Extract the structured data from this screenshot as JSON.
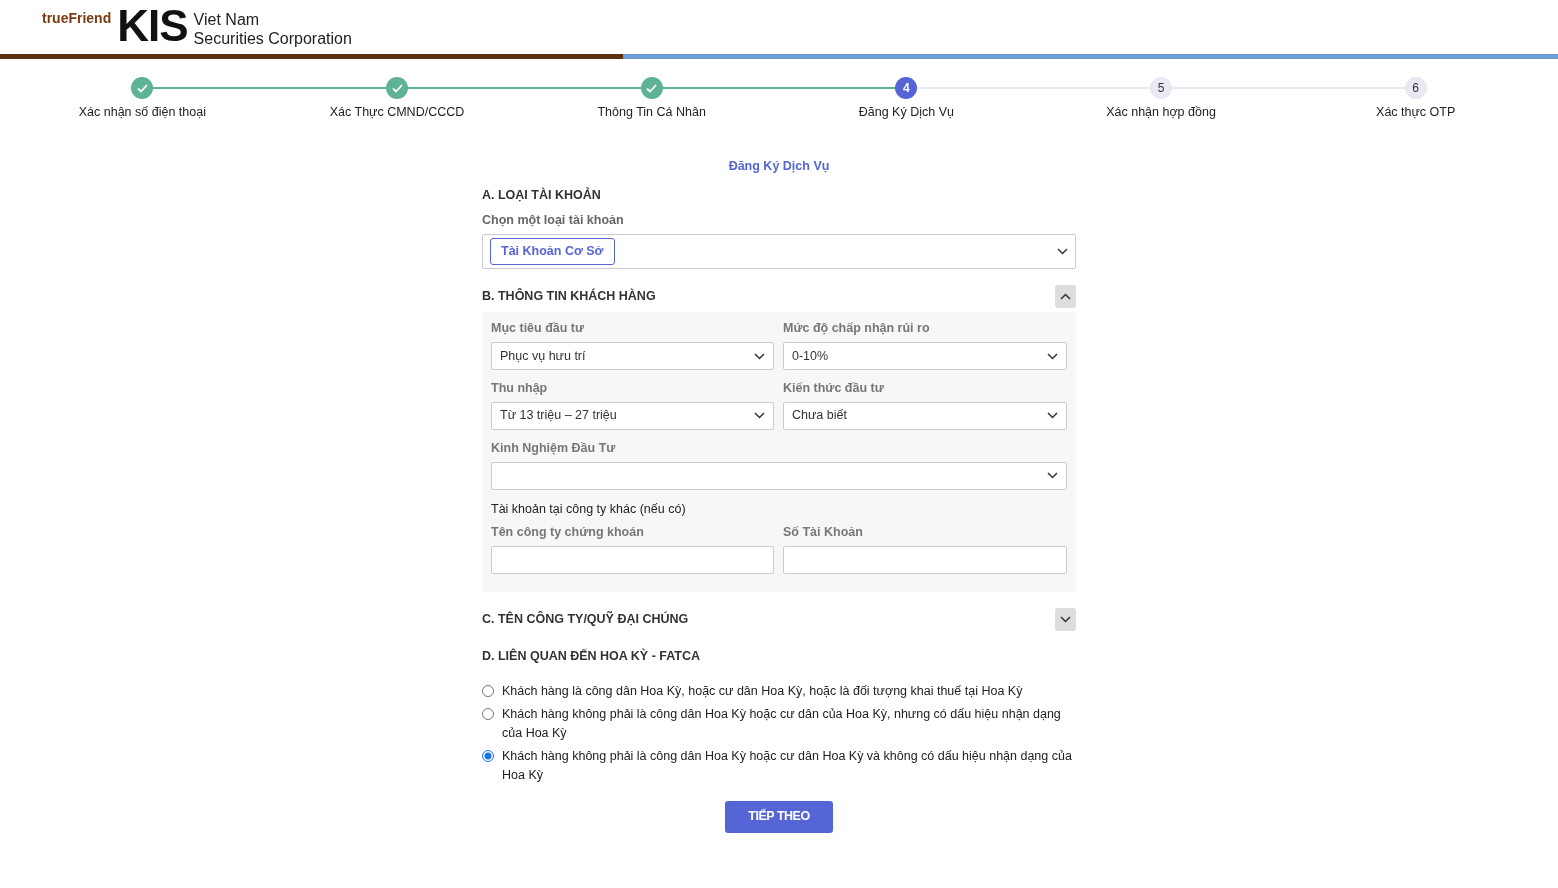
{
  "header": {
    "brand_tagline": "trueFriend",
    "brand_logo": "KIS",
    "company_line_1": "Viet Nam",
    "company_line_2": "Securities Corporation"
  },
  "steps": [
    {
      "label": "Xác nhận số điện thoại",
      "completed": true,
      "selected": false
    },
    {
      "label": "Xác Thực CMND/CCCD",
      "completed": true,
      "selected": false
    },
    {
      "label": "Thông Tin Cá Nhân",
      "completed": true,
      "selected": false
    },
    {
      "number": "4",
      "label": "Đăng Ký Dịch Vụ",
      "completed": false,
      "selected": true
    },
    {
      "number": "5",
      "label": "Xác nhận hợp đồng",
      "completed": false,
      "selected": false
    },
    {
      "number": "6",
      "label": "Xác thực OTP",
      "completed": false,
      "selected": false
    }
  ],
  "form_title": "Đăng Ký Dịch Vụ",
  "section_a": {
    "title": "A. LOẠI TÀI KHOẢN",
    "label": "Chọn một loại tài khoản",
    "chips": [
      "Tài Khoản Cơ Sở"
    ]
  },
  "section_b": {
    "title": "B. THÔNG TIN KHÁCH HÀNG",
    "expanded": true,
    "fields": [
      {
        "kind": "select",
        "label": "Mục tiêu đầu tư",
        "value": "Phục vụ hưu trí"
      },
      {
        "kind": "select",
        "label": "Mức độ chấp nhận rủi ro",
        "value": "0-10%"
      },
      {
        "kind": "select",
        "label": "Thu nhập",
        "value": "Từ 13 triệu – 27 triệu"
      },
      {
        "kind": "select",
        "label": "Kiến thức đầu tư",
        "value": "Chưa biết"
      },
      {
        "kind": "wide_select",
        "label": "Kinh Nghiệm Đầu Tư"
      },
      {
        "kind": "note",
        "label": "Tài khoản tại công ty khác (nếu có)"
      },
      {
        "kind": "text",
        "label": "Tên công ty chứng khoán"
      },
      {
        "kind": "text",
        "label": "Số Tài Khoản"
      }
    ]
  },
  "section_c": {
    "title": "C. TÊN CÔNG TY/QUỸ ĐẠI CHÚNG",
    "expanded": false
  },
  "section_d": {
    "title": "D. LIÊN QUAN ĐẾN HOA KỲ - FATCA",
    "options": [
      {
        "label": "Khách hàng là công dân Hoa Kỳ, hoặc cư dân Hoa Kỳ, hoặc là đối tượng khai thuế tại Hoa Kỳ",
        "selected": false
      },
      {
        "label": "Khách hàng không phải là công dân Hoa Kỳ hoặc cư dân của Hoa Kỳ, nhưng có dấu hiệu nhận dạng của Hoa Kỳ",
        "selected": false
      },
      {
        "label": "Khách hàng không phải là công dân Hoa Kỳ hoặc cư dân Hoa Kỳ và không có dấu hiệu nhận dạng của Hoa Kỳ",
        "selected": true
      }
    ]
  },
  "next_button": "TIẾP THEO"
}
